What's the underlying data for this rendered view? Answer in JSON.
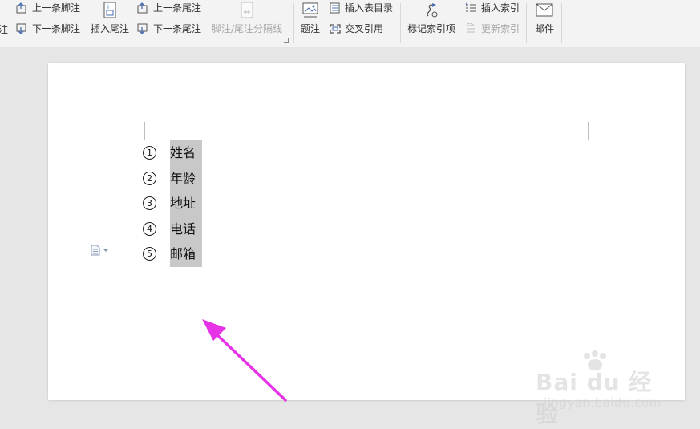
{
  "ribbon": {
    "prev_footnote": "上一条脚注",
    "next_footnote": "下一条脚注",
    "insert_endnote": "插入尾注",
    "prev_endnote": "上一条尾注",
    "next_endnote": "下一条尾注",
    "footnote_separator": "脚注/尾注分隔线",
    "caption": "题注",
    "insert_toc": "插入表目录",
    "cross_reference": "交叉引用",
    "mark_index_entry": "标记索引项",
    "insert_index": "插入索引",
    "update_index": "更新索引",
    "mail": "邮件",
    "left_cut_1": "注",
    "left_cut_2": "注"
  },
  "document": {
    "list": [
      {
        "num": "1",
        "text": "姓名"
      },
      {
        "num": "2",
        "text": "年龄"
      },
      {
        "num": "3",
        "text": "地址"
      },
      {
        "num": "4",
        "text": "电话"
      },
      {
        "num": "5",
        "text": "邮箱"
      }
    ]
  },
  "watermark": {
    "brand": "Bai du 经验",
    "url": "jingyan.baidu.com"
  },
  "colors": {
    "highlight": "#c8c8c8",
    "arrow": "#e633e6",
    "ribbon_bg": "#f3f3f3",
    "icon_blue": "#4a6fb3"
  }
}
